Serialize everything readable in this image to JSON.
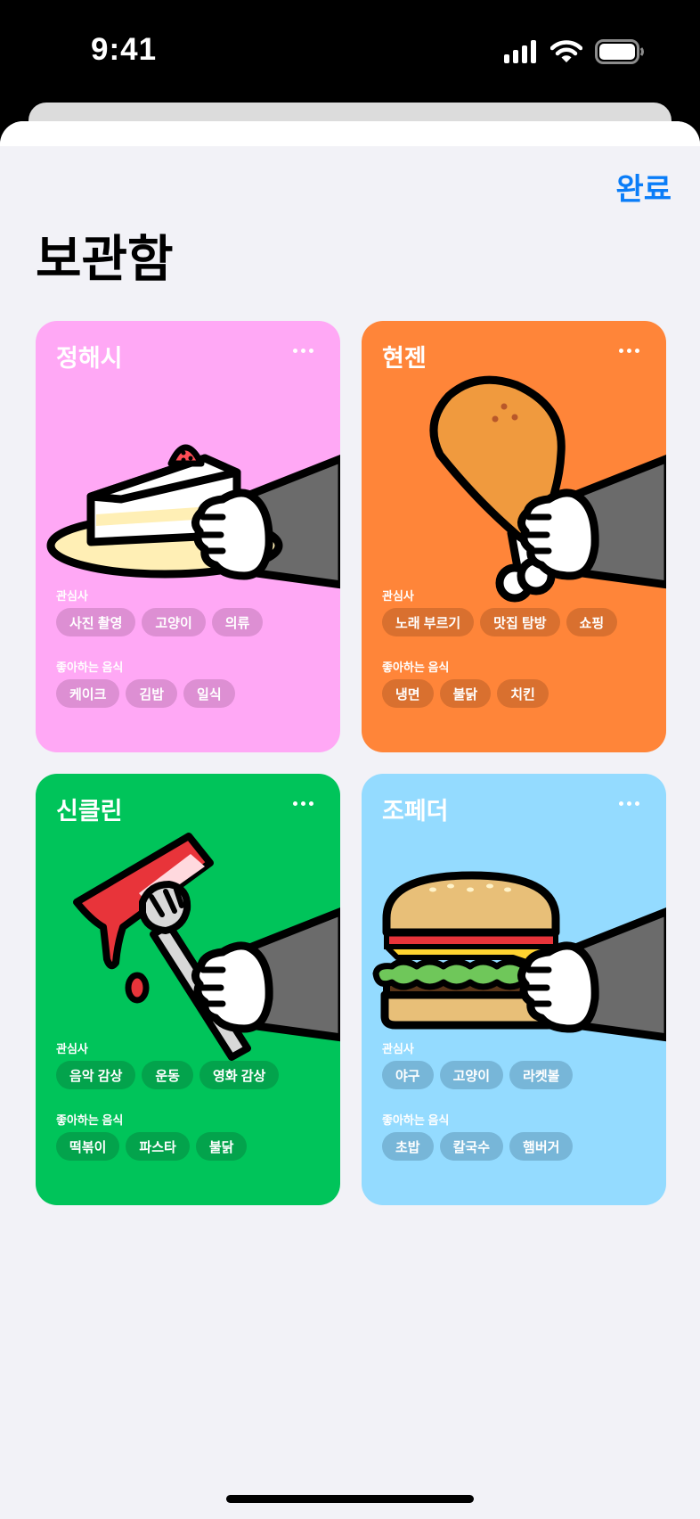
{
  "status": {
    "time": "9:41"
  },
  "header": {
    "done_label": "완료",
    "title": "보관함"
  },
  "labels": {
    "interests": "관심사",
    "foods": "좋아하는 음식"
  },
  "colors": {
    "accent": "#0a7df8",
    "background": "#f2f2f7"
  },
  "cards": [
    {
      "name": "정해시",
      "bg": "#ffa8f5",
      "tag_bg": "#dd8fd3",
      "illustration": "cake-slice",
      "interests": [
        "사진 촬영",
        "고양이",
        "의류"
      ],
      "foods": [
        "케이크",
        "김밥",
        "일식"
      ]
    },
    {
      "name": "현젠",
      "bg": "#ff8539",
      "tag_bg": "#d9702f",
      "illustration": "chicken-drumstick",
      "interests": [
        "노래 부르기",
        "맛집 탐방",
        "쇼핑"
      ],
      "foods": [
        "냉면",
        "불닭",
        "치킨"
      ]
    },
    {
      "name": "신클린",
      "bg": "#00c45a",
      "tag_bg": "#03a34c",
      "illustration": "tteokbokki-fork",
      "interests": [
        "음악 감상",
        "운동",
        "영화 감상"
      ],
      "foods": [
        "떡볶이",
        "파스타",
        "불닭"
      ]
    },
    {
      "name": "조페더",
      "bg": "#94dbff",
      "tag_bg": "#77b6d8",
      "illustration": "hamburger",
      "interests": [
        "야구",
        "고양이",
        "라켓볼"
      ],
      "foods": [
        "초밥",
        "칼국수",
        "햄버거"
      ]
    }
  ]
}
